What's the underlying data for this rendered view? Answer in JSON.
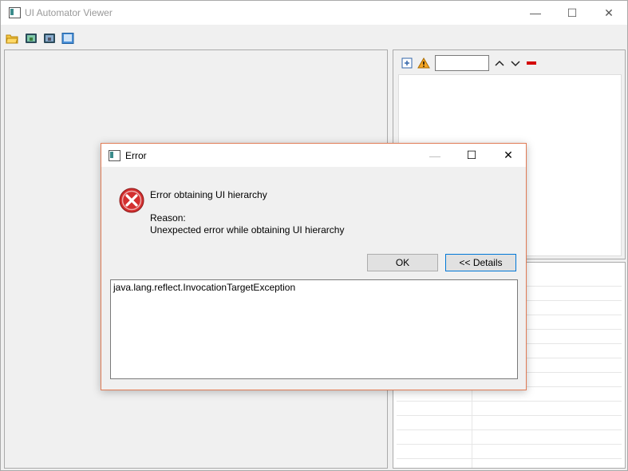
{
  "app": {
    "title": "UI Automator Viewer",
    "window_controls": {
      "minimize": "—",
      "maximize": "☐",
      "close": "✕"
    }
  },
  "toolbar": {
    "items": [
      {
        "icon": "open-folder-icon"
      },
      {
        "icon": "device-screenshot-icon"
      },
      {
        "icon": "device-screenshot-compressed-icon"
      },
      {
        "icon": "save-icon"
      }
    ]
  },
  "hierarchy_toolbar": {
    "search_value": "",
    "icons": [
      "expand-all-icon",
      "warning-icon",
      "previous-icon",
      "next-icon",
      "clear-icon"
    ]
  },
  "dialog": {
    "title": "Error",
    "controls": {
      "minimize": "—",
      "maximize": "☐",
      "close": "✕"
    },
    "message_title": "Error obtaining UI hierarchy",
    "reason_label": "Reason:",
    "reason_text": "Unexpected error while obtaining UI hierarchy",
    "ok_label": "OK",
    "details_label": "<< Details",
    "details_text": "java.lang.reflect.InvocationTargetException"
  },
  "colors": {
    "dialog_border": "#e07b55",
    "error_red": "#d32f2f",
    "warning_orange": "#f5a623",
    "clear_red": "#d40000",
    "focus_blue": "#0078d7"
  }
}
